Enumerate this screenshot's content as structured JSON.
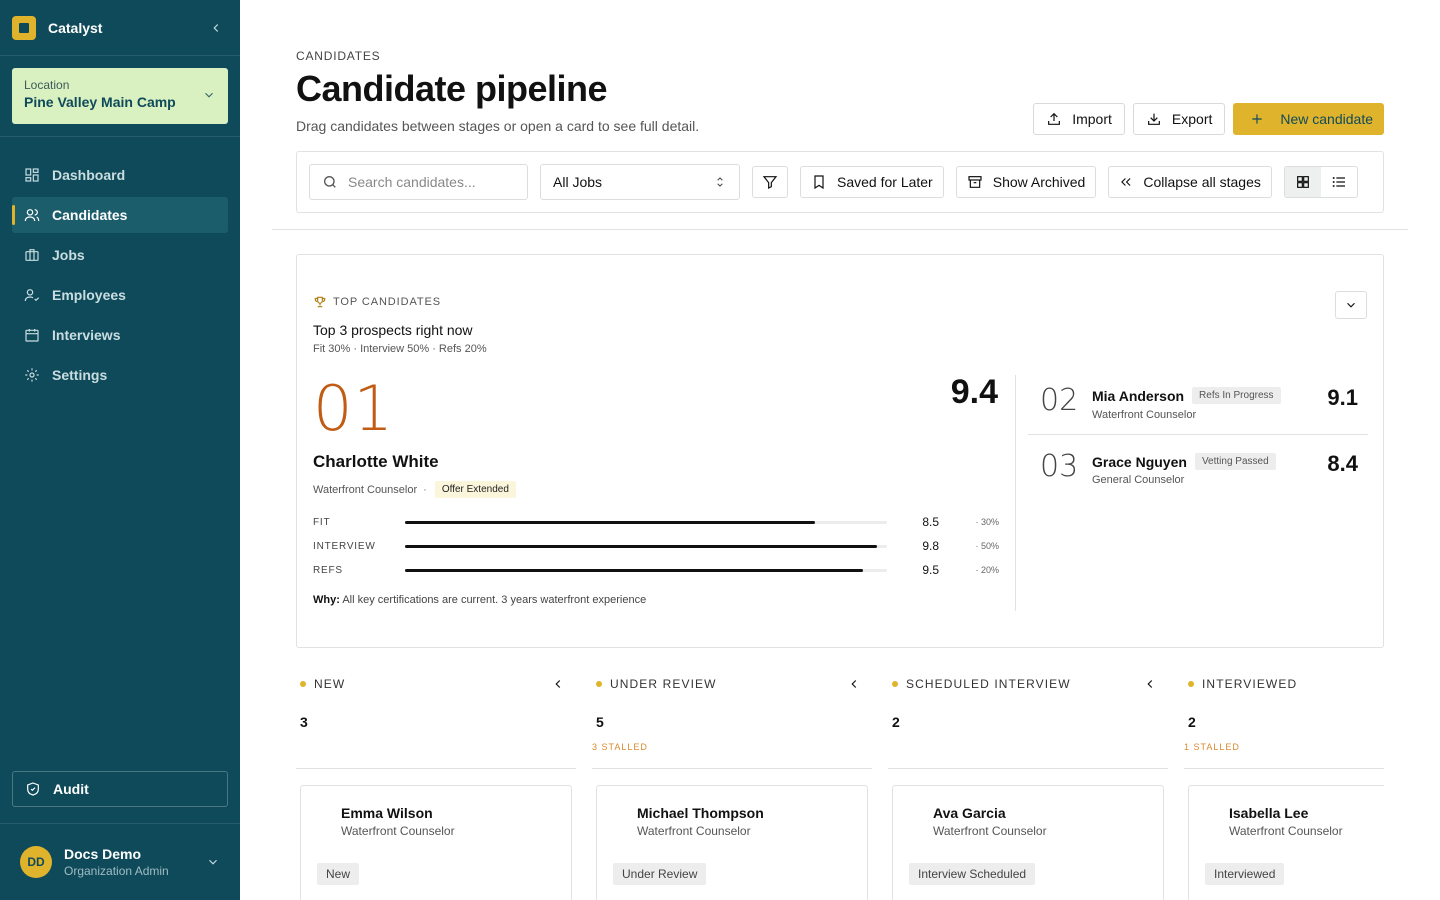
{
  "app": {
    "name": "Catalyst"
  },
  "location": {
    "label": "Location",
    "value": "Pine Valley Main Camp"
  },
  "nav": [
    {
      "label": "Dashboard",
      "icon": "dashboard-icon"
    },
    {
      "label": "Candidates",
      "icon": "users-icon",
      "active": true
    },
    {
      "label": "Jobs",
      "icon": "briefcase-icon"
    },
    {
      "label": "Employees",
      "icon": "user-check-icon"
    },
    {
      "label": "Interviews",
      "icon": "calendar-icon"
    },
    {
      "label": "Settings",
      "icon": "gear-icon"
    }
  ],
  "audit": {
    "label": "Audit"
  },
  "user": {
    "initials": "DD",
    "name": "Docs Demo",
    "role": "Organization Admin"
  },
  "header": {
    "eyebrow": "CANDIDATES",
    "title": "Candidate pipeline",
    "subtitle": "Drag candidates between stages or open a card to see full detail.",
    "import_label": "Import",
    "export_label": "Export",
    "new_label": "New candidate"
  },
  "toolbar": {
    "search_placeholder": "Search candidates...",
    "jobs_select": "All Jobs",
    "saved_label": "Saved for Later",
    "archived_label": "Show Archived",
    "collapse_label": "Collapse all stages",
    "view_mode": "grid"
  },
  "top": {
    "eyebrow": "TOP CANDIDATES",
    "title": "Top 3 prospects right now",
    "weights": "Fit 30% · Interview 50% · Refs 20%",
    "first": {
      "rank": "01",
      "score": "9.4",
      "name": "Charlotte White",
      "role": "Waterfront Counselor",
      "status": "Offer Extended",
      "metrics": [
        {
          "label": "FIT",
          "value": "8.5",
          "fraction": 0.85,
          "weight": "· 30%"
        },
        {
          "label": "INTERVIEW",
          "value": "9.8",
          "fraction": 0.98,
          "weight": "· 50%"
        },
        {
          "label": "REFS",
          "value": "9.5",
          "fraction": 0.95,
          "weight": "· 20%"
        }
      ],
      "why_label": "Why:",
      "why_text": "All key certifications are current. 3 years waterfront experience"
    },
    "others": [
      {
        "rank": "02",
        "name": "Mia Anderson",
        "status": "Refs In Progress",
        "role": "Waterfront Counselor",
        "score": "9.1"
      },
      {
        "rank": "03",
        "name": "Grace Nguyen",
        "status": "Vetting Passed",
        "role": "General Counselor",
        "score": "8.4"
      }
    ]
  },
  "columns": [
    {
      "title": "NEW",
      "count": "3",
      "stalled": "",
      "card": {
        "name": "Emma Wilson",
        "role": "Waterfront Counselor",
        "status": "New"
      }
    },
    {
      "title": "UNDER REVIEW",
      "count": "5",
      "stalled": "3 STALLED",
      "card": {
        "name": "Michael Thompson",
        "role": "Waterfront Counselor",
        "status": "Under Review"
      }
    },
    {
      "title": "SCHEDULED INTERVIEW",
      "count": "2",
      "stalled": "",
      "card": {
        "name": "Ava Garcia",
        "role": "Waterfront Counselor",
        "status": "Interview Scheduled"
      }
    },
    {
      "title": "INTERVIEWED",
      "count": "2",
      "stalled": "1 STALLED",
      "card": {
        "name": "Isabella Lee",
        "role": "Waterfront Counselor",
        "status": "Interviewed"
      }
    }
  ],
  "colors": {
    "sidebar": "#0f4a5a",
    "accent": "#e0b32c",
    "rank": "#c05c14",
    "location_bg": "#d9f0c0"
  }
}
